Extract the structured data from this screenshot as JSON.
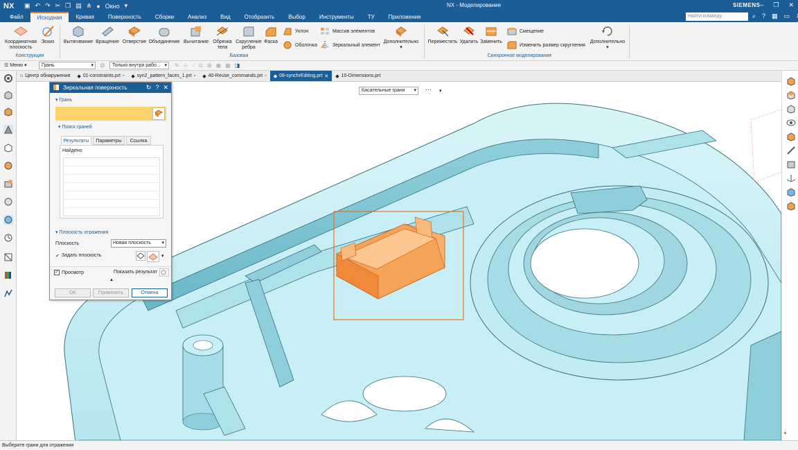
{
  "titlebar": {
    "logo": "NX",
    "window_menu": "Окно",
    "title": "NX - Моделирование",
    "brand": "SIEMENS"
  },
  "menubar": {
    "items": [
      "Файл",
      "Исходная",
      "Кривая",
      "Поверхность",
      "Сборки",
      "Анализ",
      "Вид",
      "Отобразить",
      "Выбор",
      "Инструменты",
      "ТУ",
      "Приложение"
    ],
    "active": "Исходная",
    "search_placeholder": "Найти команду (Ctrl+Space)"
  },
  "ribbon": {
    "construction": {
      "label": "Конструкция",
      "btn_csys_1": "Координатная",
      "btn_csys_2": "плоскость",
      "btn_sketch": "Эскиз"
    },
    "basic": {
      "label": "Базовая",
      "extrude": "Вытягивание",
      "revolve": "Вращение",
      "hole": "Отверстие",
      "unite": "Объединение",
      "subtract": "Вычитание",
      "trim_1": "Обрезка",
      "trim_2": "тела",
      "blend_1": "Скругление",
      "blend_2": "ребра",
      "chamfer": "Фаска",
      "draft": "Уклон",
      "shell": "Оболочка",
      "pattern": "Массив элементов",
      "mirror": "Зеркальный элемент",
      "more": "Дополнительно"
    },
    "sync": {
      "label": "Синхронное моделирование",
      "move": "Переместить",
      "delete": "Удалить",
      "replace": "Заменить",
      "offset": "Смещение",
      "resize_blend": "Изменить размер скругления",
      "more": "Дополнительно"
    }
  },
  "selbar": {
    "menu": "Меню",
    "filter": "Грань",
    "scope": "Только внутри рабо..."
  },
  "tabs": [
    {
      "label": "Центр обнаружения"
    },
    {
      "label": "01-constraints.prt"
    },
    {
      "label": "syn2_pattern_faces_1.prt"
    },
    {
      "label": "40-Reuse_commands.prt"
    },
    {
      "label": "08-synchrEditing.prt"
    },
    {
      "label": "10-Dimensions.prt"
    }
  ],
  "active_tab": "08-synchrEditing.prt",
  "viewport": {
    "face_rule": "Касательные грани"
  },
  "dialog": {
    "title": "Зеркальная поверхность",
    "face_section": "Грань",
    "find_section": "Поиск граней",
    "tabs": [
      "Результаты",
      "Параметры",
      "Ссылка"
    ],
    "found_label": "Найдено",
    "plane_section": "Плоскость отражения",
    "plane_label": "Плоскость",
    "plane_value": "Новая плоскость",
    "specify_plane": "Задать плоскость",
    "preview": "Просмотр",
    "show_result": "Показать результат",
    "ok": "OK",
    "apply": "Применить",
    "cancel": "Отмена"
  },
  "status": "Выберите грани для отражения",
  "colors": {
    "brand_blue": "#1b5e97",
    "accent_orange": "#e6761e",
    "part_cyan": "#c5eef4",
    "selection_yellow": "#fcd36b"
  }
}
